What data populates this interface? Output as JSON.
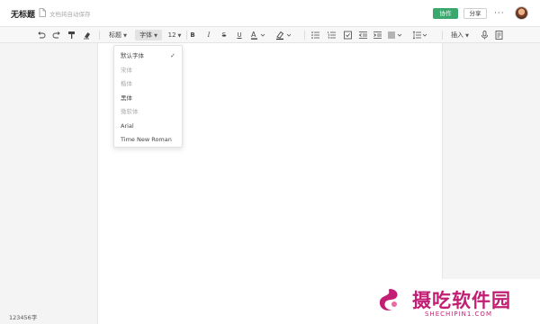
{
  "topbar": {
    "title": "无标题",
    "save_status": "文档将自动保存",
    "collab_label": "协作",
    "share_label": "分享",
    "more_label": "···"
  },
  "toolbar": {
    "heading_label": "标题",
    "font_label": "字体",
    "font_size": "12",
    "insert_label": "插入"
  },
  "font_menu": {
    "items": [
      {
        "label": "默认字体",
        "selected": true
      },
      {
        "label": "宋体"
      },
      {
        "label": "楷体"
      },
      {
        "label": "黑体"
      },
      {
        "label": "微软体"
      },
      {
        "label": "Arial"
      },
      {
        "label": "Time New Roman"
      }
    ],
    "check": "✓"
  },
  "status": {
    "word_count": "123456字"
  },
  "watermark": {
    "name": "摄吃软件园",
    "url": "SHECHIPIN1.COM"
  },
  "colors": {
    "accent_green": "#3aa76d",
    "watermark_pink": "#c21e73"
  }
}
